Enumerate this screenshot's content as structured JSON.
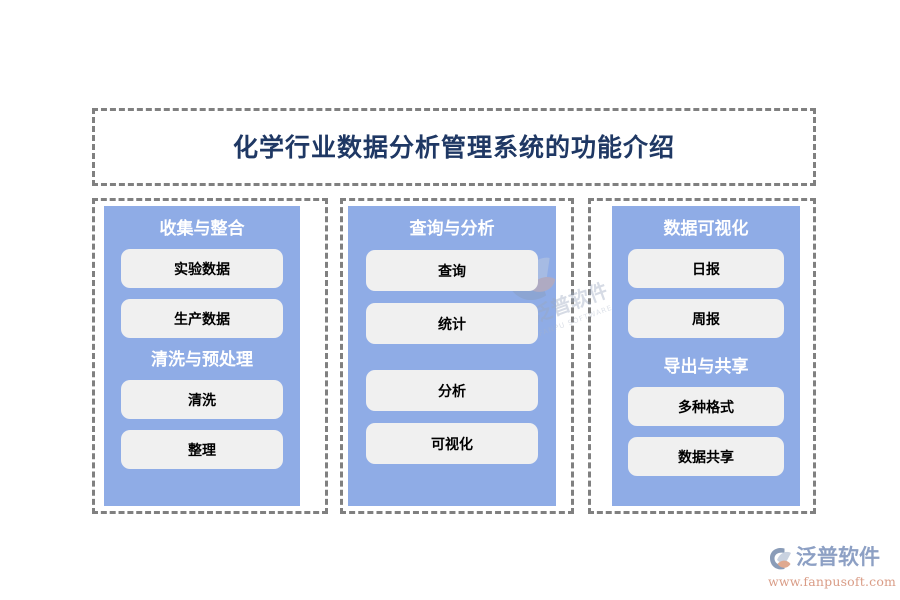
{
  "page": {
    "title": "化学行业数据分析管理系统的功能介绍",
    "background_color": "#FFFFFF",
    "title_color": "#1F3864",
    "panel_color": "#8FACE6",
    "box_color": "#F0F0F0",
    "dash_color": "#808080"
  },
  "columns": [
    {
      "id": "collection",
      "groups": [
        {
          "header": "收集与整合",
          "items": [
            "实验数据",
            "生产数据"
          ]
        },
        {
          "header": "清洗与预处理",
          "items": [
            "清洗",
            "整理"
          ]
        }
      ]
    },
    {
      "id": "query",
      "groups": [
        {
          "header": "查询与分析",
          "items": [
            "查询",
            "统计",
            "分析",
            "可视化"
          ]
        }
      ]
    },
    {
      "id": "visualization",
      "groups": [
        {
          "header": "数据可视化",
          "items": [
            "日报",
            "周报"
          ]
        },
        {
          "header": "导出与共享",
          "items": [
            "多种格式",
            "数据共享"
          ]
        }
      ]
    }
  ],
  "brand": {
    "name": "泛普软件",
    "url": "www.fanpusoft.com",
    "name_color": "#8DA0C4",
    "url_color": "#D99C86",
    "mark_icon": "fanpu-swoosh-logo-icon"
  },
  "watermark": {
    "icon": "fanpu-swoosh-watermark-icon",
    "name": "泛普软件",
    "url": "FANPU SOFTWARE"
  }
}
